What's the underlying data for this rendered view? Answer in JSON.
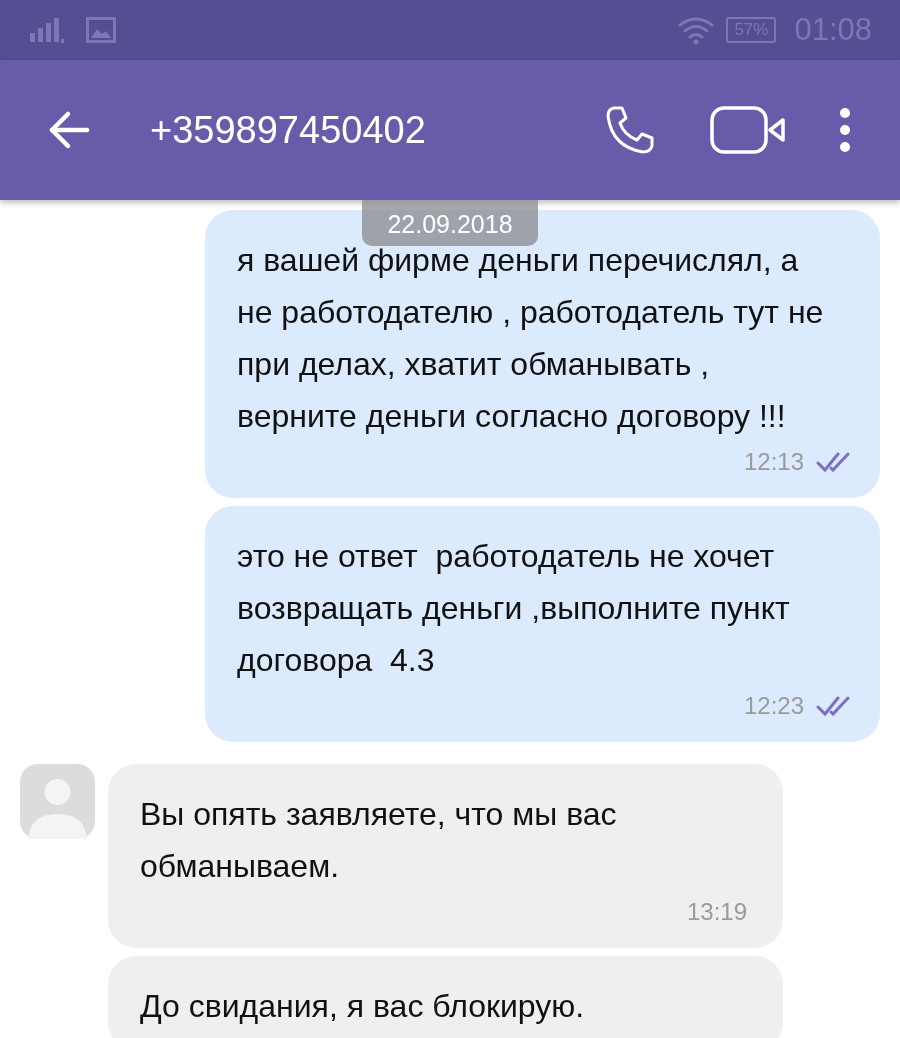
{
  "status_bar": {
    "battery": "57%",
    "time": "01:08"
  },
  "header": {
    "title": "+359897450402"
  },
  "date_chip": "22.09.2018",
  "messages": [
    {
      "kind": "outgoing",
      "text": "я вашей фирме деньги перечислял, а не работодателю , работодатель тут не при делах, хватит обманывать , верните деньги согласно договору !!!",
      "time": "12:13",
      "read": true
    },
    {
      "kind": "outgoing",
      "text": "это не ответ  работодатель не хочет возвращать деньги ,выполните пункт договора  4.3",
      "time": "12:23",
      "read": true
    },
    {
      "kind": "incoming",
      "text": "Вы опять заявляете, что мы вас обманываем.",
      "time": "13:19",
      "avatar": true
    },
    {
      "kind": "incoming",
      "text": "До свидания, я вас блокирую."
    }
  ]
}
